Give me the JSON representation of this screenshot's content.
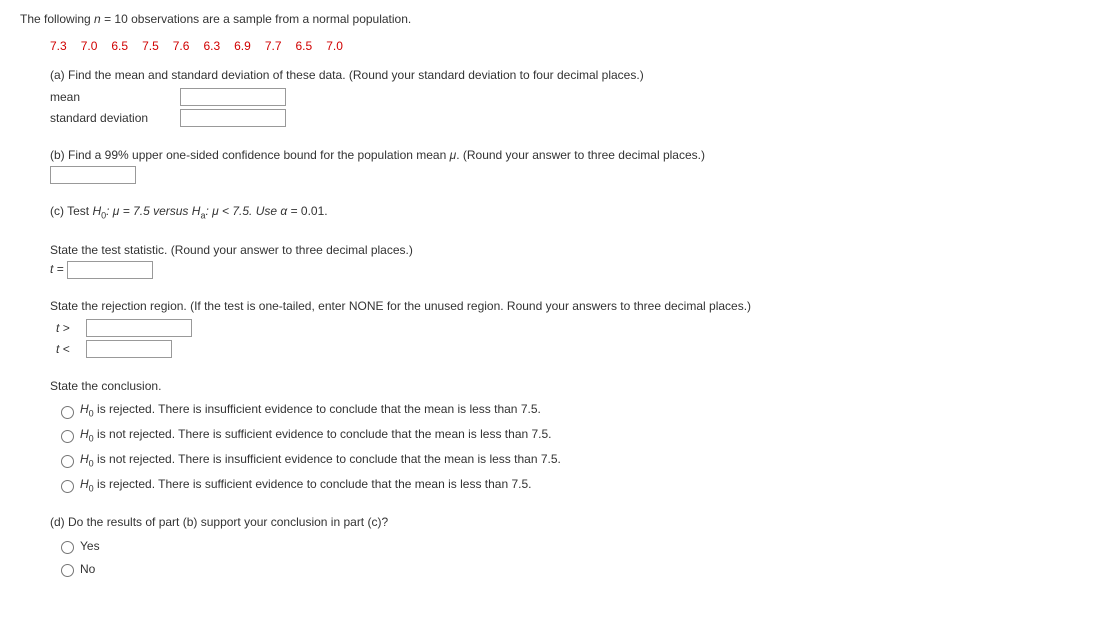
{
  "intro": {
    "prefix": "The following ",
    "nvar": "n",
    "eq": " = 10 observations are a sample from a normal population."
  },
  "data_values": [
    "7.3",
    "7.0",
    "6.5",
    "7.5",
    "7.6",
    "6.3",
    "6.9",
    "7.7",
    "6.5",
    "7.0"
  ],
  "part_a": {
    "prompt": "(a) Find the mean and standard deviation of these data. (Round your standard deviation to four decimal places.)",
    "mean_label": "mean",
    "sd_label": "standard deviation"
  },
  "part_b": {
    "prompt_prefix": "(b) Find a 99% upper one-sided confidence bound for the population mean ",
    "mu": "μ",
    "prompt_suffix": ". (Round your answer to three decimal places.)"
  },
  "part_c": {
    "prefix": "(c) Test ",
    "h0": "H",
    "h0_sub": "0",
    "colon_mu": ": μ = 7.5 versus ",
    "ha": "H",
    "ha_sub": "a",
    "ha_colon": ": μ < 7.5. Use ",
    "alpha": "α",
    "alpha_eq": " = 0.01."
  },
  "test_stat": {
    "prompt": "State the test statistic. (Round your answer to three decimal places.)",
    "label": "t = "
  },
  "rejection": {
    "prompt": "State the rejection region. (If the test is one-tailed, enter NONE for the unused region. Round your answers to three decimal places.)",
    "gt": "t >",
    "lt": "t <"
  },
  "conclusion": {
    "heading": "State the conclusion.",
    "options": [
      {
        "h": "H",
        "sub": "0",
        "rest": " is rejected. There is insufficient evidence to conclude that the mean is less than 7.5."
      },
      {
        "h": "H",
        "sub": "0",
        "rest": " is not rejected. There is sufficient evidence to conclude that the mean is less than 7.5."
      },
      {
        "h": "H",
        "sub": "0",
        "rest": " is not rejected. There is insufficient evidence to conclude that the mean is less than 7.5."
      },
      {
        "h": "H",
        "sub": "0",
        "rest": " is rejected. There is sufficient evidence to conclude that the mean is less than 7.5."
      }
    ]
  },
  "part_d": {
    "prompt": "(d) Do the results of part (b) support your conclusion in part (c)?",
    "yes": "Yes",
    "no": "No"
  }
}
